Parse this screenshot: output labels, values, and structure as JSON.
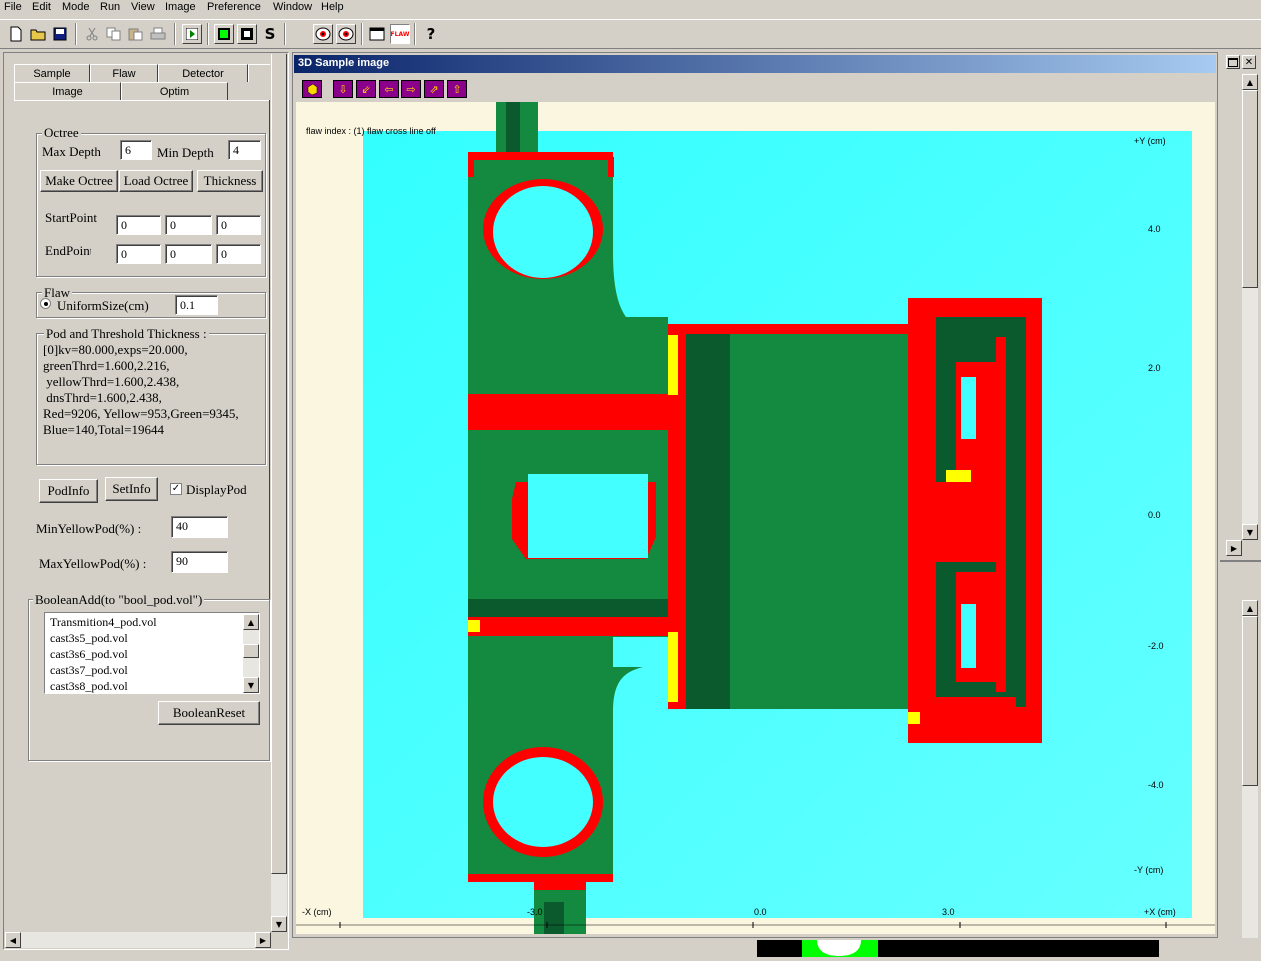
{
  "menu": [
    "File",
    "Edit",
    "Mode",
    "Run",
    "View",
    "Image",
    "Preference",
    "Window",
    "Help"
  ],
  "toolbar": {
    "icons": [
      "new-icon",
      "open-icon",
      "save-icon",
      "cut-icon",
      "copy-icon",
      "paste-icon",
      "print-icon",
      "run-icon",
      "view-green-icon",
      "view-black-icon",
      "s-icon",
      "eye-left-icon",
      "eye-right-icon",
      "window-icon",
      "flaw-icon",
      "help-icon"
    ],
    "s_label": "S",
    "help_label": "?",
    "flaw_label": "FLAW"
  },
  "tabs": {
    "row1": [
      "Sample",
      "Flaw",
      "Detector"
    ],
    "row2": [
      "Image",
      "Optim"
    ]
  },
  "octree": {
    "title": "Octree",
    "max_depth_label": "Max Depth",
    "max_depth": "6",
    "min_depth_label": "Min Depth",
    "min_depth": "4",
    "make_btn": "Make Octree",
    "load_btn": "Load Octree",
    "thickness_btn": "Thickness",
    "start_label": "StartPoint",
    "end_label": "EndPoint",
    "start": [
      "0",
      "0",
      "0"
    ],
    "end": [
      "0",
      "0",
      "0"
    ]
  },
  "flaw": {
    "title": "Flaw",
    "uniform_label": "UniformSize(cm)",
    "uniform_value": "0.1"
  },
  "pod": {
    "title": "Pod and Threshold Thickness :",
    "lines": [
      "[0]kv=80.000,exps=20.000,",
      "greenThrd=1.600,2.216,",
      " yellowThrd=1.600,2.438,",
      " dnsThrd=1.600,2.438,",
      "Red=9206, Yellow=953,Green=9345,",
      "Blue=140,Total=19644"
    ]
  },
  "podinfo_btn": "PodInfo",
  "setinfo_btn": "SetInfo",
  "displaypod_label": "DisplayPod",
  "min_yellow_label": "MinYellowPod(%) :",
  "min_yellow": "40",
  "max_yellow_label": "MaxYellowPod(%) :",
  "max_yellow": "90",
  "boolean": {
    "title": "BooleanAdd(to \"bool_pod.vol\")",
    "items": [
      "Transmition4_pod.vol",
      "cast3s5_pod.vol",
      "cast3s6_pod.vol",
      "cast3s7_pod.vol",
      "cast3s8_pod.vol"
    ],
    "reset_btn": "BooleanReset"
  },
  "window": {
    "title": "3D Sample image",
    "buttons": [
      "cube-icon",
      "arrow-down-icon",
      "diag-down-icon",
      "arrow-left-icon",
      "arrow-right-icon",
      "diag-up-icon",
      "arrow-up-icon"
    ],
    "info": "flaw index : (1) flaw cross line off",
    "y_labels": {
      "top": "+Y (cm)",
      "bottom": "-Y (cm)",
      "ticks": [
        "4.0",
        "2.0",
        "0.0",
        "-2.0",
        "-4.0"
      ]
    },
    "x_labels": {
      "left": "-X (cm)",
      "right": "+X (cm)",
      "ticks": [
        "-3.0",
        "0.0",
        "3.0"
      ]
    }
  },
  "colors": {
    "bg": "#d4d0c8",
    "cyan": "#44ffff",
    "green": "#138a3f",
    "darkgreen": "#0b5a2e",
    "red": "#ff0000",
    "yellow": "#ffff00",
    "title_start": "#0a246a",
    "title_end": "#a6caf0"
  }
}
